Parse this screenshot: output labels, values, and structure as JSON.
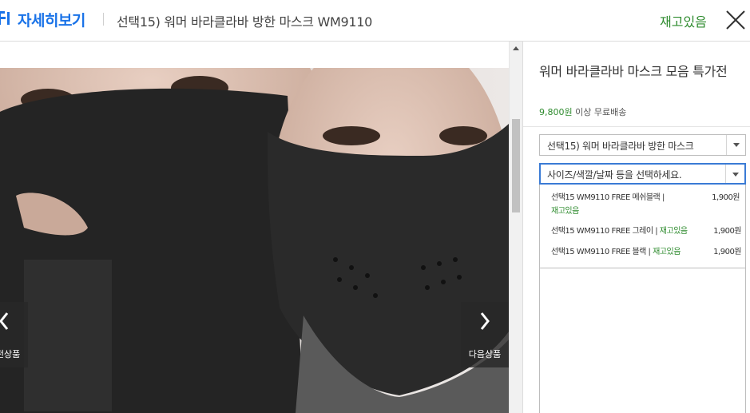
{
  "header": {
    "title": "자세히보기",
    "product_name": "선택15) 워머 바라클라바 방한 마스크 WM9110",
    "stock_status": "재고있음"
  },
  "viewer": {
    "prev_label": "이전상품",
    "next_label": "다음상품"
  },
  "panel": {
    "title": "워머 바라클라바 마스크 모음 특가전",
    "shipping_amount": "9,800원",
    "shipping_text": " 이상 무료배송",
    "select_product": "선택15) 워머 바라클라바 방한 마스크",
    "select_option_placeholder": "사이즈/색깔/날짜 등을 선택하세요.",
    "options": [
      {
        "name": "선택15 WM9110 FREE 메쉬블랙 | ",
        "stock": "재고있음",
        "price": "1,900원"
      },
      {
        "name": "선택15 WM9110 FREE 그레이 | ",
        "stock": "재고있음",
        "price": "1,900원"
      },
      {
        "name": "선택15 WM9110 FREE 블랙 | ",
        "stock": "재고있음",
        "price": "1,900원"
      }
    ]
  },
  "colors": {
    "brand_blue": "#1a73e8",
    "stock_green": "#2e8b2e",
    "select_focus": "#3a7bd5"
  }
}
